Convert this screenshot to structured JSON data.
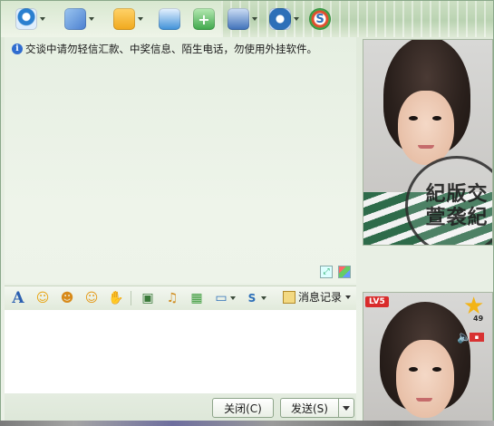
{
  "toolbar": {
    "buttons": [
      {
        "name": "video-chat-icon",
        "color": "#2a7fcf"
      },
      {
        "name": "voice-chat-icon",
        "color": "#4a7fd0"
      },
      {
        "name": "send-file-icon",
        "color": "#f0a81c"
      },
      {
        "name": "send-mail-icon",
        "color": "#3c8fd8"
      },
      {
        "name": "add-app-icon",
        "color": "#3ea74a"
      },
      {
        "name": "group-chat-icon",
        "color": "#3d6fb8"
      },
      {
        "name": "settings-icon",
        "color": "#2d6fb8"
      },
      {
        "name": "soso-icon",
        "color": "#e04e2e"
      }
    ]
  },
  "chat": {
    "notice": "交谈中请勿轻信汇款、中奖信息、陌生电话，勿使用外挂软件。"
  },
  "format_bar": {
    "icons": [
      "font-icon",
      "emoticon-icon",
      "magic-face-icon",
      "wink-icon",
      "nudge-icon",
      "image-icon",
      "music-icon",
      "gift-icon",
      "screen-capture-icon",
      "soso-search-icon"
    ],
    "history_label": "消息记录"
  },
  "buttons": {
    "close_label": "关闭(C)",
    "send_label": "发送(S)"
  },
  "contact": {
    "level_badge": "LV5",
    "star_count": "49"
  },
  "photo_stamp": [
    "紀版交",
    "萱袭紀"
  ]
}
